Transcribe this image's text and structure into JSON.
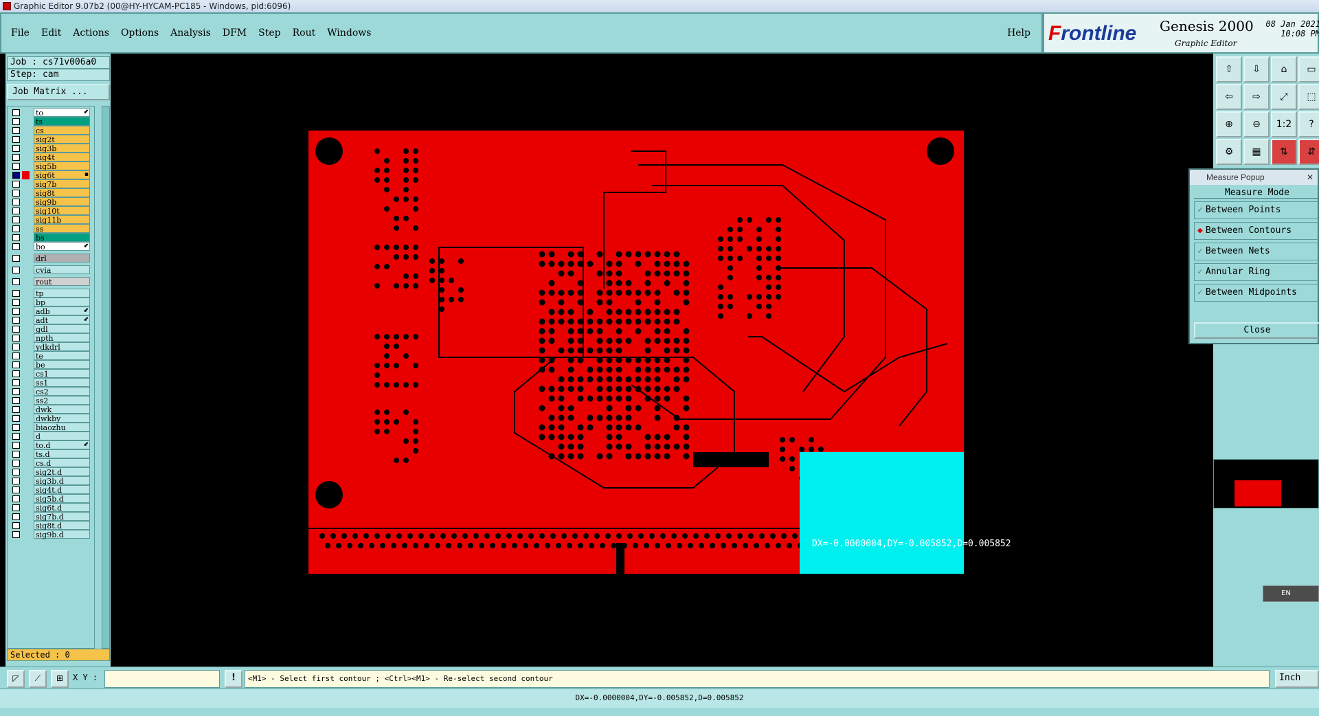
{
  "window": {
    "title": "Graphic Editor 9.07b2 (00@HY-HYCAM-PC185 - Windows, pid:6096)"
  },
  "menu": {
    "items": [
      "File",
      "Edit",
      "Actions",
      "Options",
      "Analysis",
      "DFM",
      "Step",
      "Rout",
      "Windows"
    ],
    "help": "Help"
  },
  "brand": {
    "logo_pre": "F",
    "logo_rest": "rontline",
    "product": "Genesis 2000",
    "subtitle": "Graphic Editor",
    "date": "08 Jan 2021",
    "time": "10:08 PM"
  },
  "job": {
    "job": "Job : cs71v006a0",
    "step": "Step: cam",
    "matrix_button": "Job Matrix ..."
  },
  "layers": [
    {
      "name": "to",
      "color": "#ffffff",
      "mark": "⬋"
    },
    {
      "name": "ts",
      "color": "#00a080"
    },
    {
      "name": "cs",
      "color": "#f5c24a"
    },
    {
      "name": "sig2t",
      "color": "#f5c24a"
    },
    {
      "name": "sig3b",
      "color": "#f5c24a"
    },
    {
      "name": "sig4t",
      "color": "#f5c24a"
    },
    {
      "name": "sig5b",
      "color": "#f5c24a"
    },
    {
      "name": "sig6t",
      "color": "#f5c24a",
      "active": true,
      "swatch": "#e80000",
      "mark": "▪"
    },
    {
      "name": "sig7b",
      "color": "#f5c24a"
    },
    {
      "name": "sig8t",
      "color": "#f5c24a"
    },
    {
      "name": "sig9b",
      "color": "#f5c24a"
    },
    {
      "name": "sig10t",
      "color": "#f5c24a"
    },
    {
      "name": "sig11b",
      "color": "#f5c24a"
    },
    {
      "name": "ss",
      "color": "#f5c24a"
    },
    {
      "name": "bs",
      "color": "#00a080"
    },
    {
      "name": "bo",
      "color": "#ffffff",
      "mark": "⬋"
    },
    {
      "name": "drl",
      "color": "#b0b0b0",
      "gap": true
    },
    {
      "name": "cvia",
      "color": "#b9e6e6",
      "gap": true
    },
    {
      "name": "rout",
      "color": "#d0d0d0",
      "gap": true
    },
    {
      "name": "tp",
      "color": "#b9e6e6",
      "gap": true
    },
    {
      "name": "bp",
      "color": "#b9e6e6"
    },
    {
      "name": "adb",
      "color": "#b9e6e6",
      "mark": "⬋"
    },
    {
      "name": "adt",
      "color": "#b9e6e6",
      "mark": "⬋"
    },
    {
      "name": "gdl",
      "color": "#b9e6e6"
    },
    {
      "name": "npth",
      "color": "#b9e6e6"
    },
    {
      "name": "ydkdrl",
      "color": "#b9e6e6"
    },
    {
      "name": "te",
      "color": "#b9e6e6"
    },
    {
      "name": "be",
      "color": "#b9e6e6"
    },
    {
      "name": "cs1",
      "color": "#b9e6e6"
    },
    {
      "name": "ss1",
      "color": "#b9e6e6"
    },
    {
      "name": "cs2",
      "color": "#b9e6e6"
    },
    {
      "name": "ss2",
      "color": "#b9e6e6"
    },
    {
      "name": "dwk",
      "color": "#b9e6e6"
    },
    {
      "name": "dwkby",
      "color": "#b9e6e6"
    },
    {
      "name": "biaozhu",
      "color": "#b9e6e6"
    },
    {
      "name": "d",
      "color": "#b9e6e6"
    },
    {
      "name": "to.d",
      "color": "#b9e6e6",
      "mark": "⬋"
    },
    {
      "name": "ts.d",
      "color": "#b9e6e6"
    },
    {
      "name": "cs.d",
      "color": "#b9e6e6"
    },
    {
      "name": "sig2t.d",
      "color": "#b9e6e6"
    },
    {
      "name": "sig3b.d",
      "color": "#b9e6e6"
    },
    {
      "name": "sig4t.d",
      "color": "#b9e6e6"
    },
    {
      "name": "sig5b.d",
      "color": "#b9e6e6"
    },
    {
      "name": "sig6t.d",
      "color": "#b9e6e6"
    },
    {
      "name": "sig7b.d",
      "color": "#b9e6e6"
    },
    {
      "name": "sig8t.d",
      "color": "#b9e6e6"
    },
    {
      "name": "sig9b.d",
      "color": "#b9e6e6"
    }
  ],
  "selected": "Selected : 0",
  "measure": {
    "title": "Measure Popup",
    "mode_label": "Measure Mode",
    "options": [
      {
        "label": "Between Points",
        "selected": false
      },
      {
        "label": "Between Contours",
        "selected": true
      },
      {
        "label": "Between Nets",
        "selected": false
      },
      {
        "label": "Annular Ring",
        "selected": false
      },
      {
        "label": "Between Midpoints",
        "selected": false
      }
    ],
    "close": "Close"
  },
  "canvas": {
    "measure_readout": "DX=-0.0000004,DY=-0.005852,D=0.005852"
  },
  "tools": {
    "one_to_two": "1:2",
    "help": "?"
  },
  "bottom": {
    "xy_label": "X Y :",
    "xy_value": "",
    "excl": "!",
    "prompt": "<M1> - Select first contour ; <Ctrl><M1> - Re-select second contour",
    "units": "Inch"
  },
  "status": "DX=-0.0000004,DY=-0.005852,D=0.005852",
  "lang": "EN"
}
